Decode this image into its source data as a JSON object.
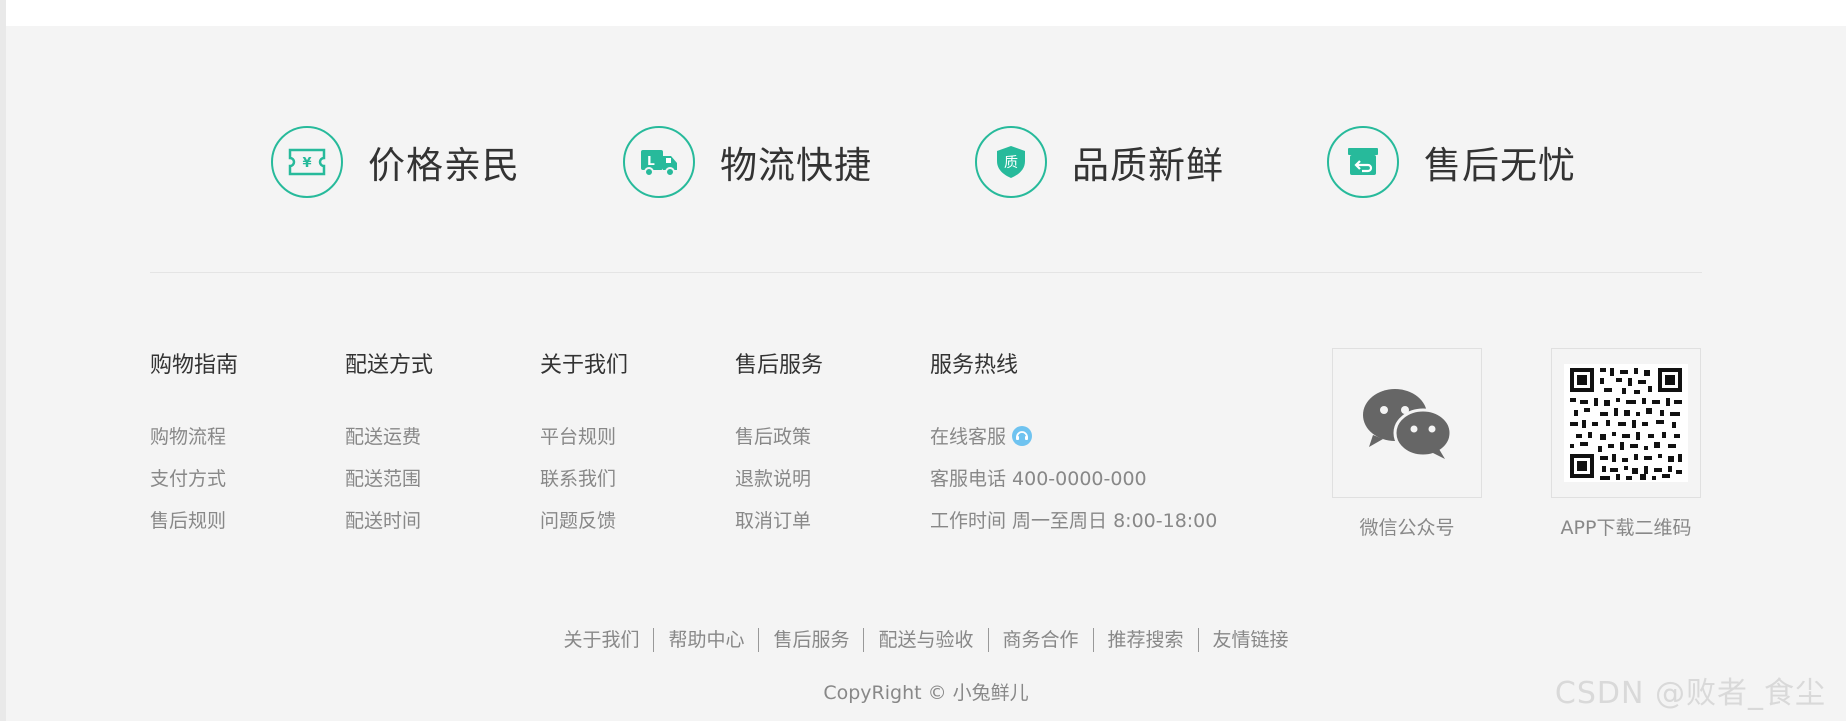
{
  "features": [
    {
      "label": "价格亲民",
      "icon": "ticket-yuan-icon"
    },
    {
      "label": "物流快捷",
      "icon": "delivery-truck-icon"
    },
    {
      "label": "品质新鲜",
      "icon": "quality-shield-icon"
    },
    {
      "label": "售后无忧",
      "icon": "return-box-icon"
    }
  ],
  "columns": [
    {
      "title": "购物指南",
      "links": [
        "购物流程",
        "支付方式",
        "售后规则"
      ]
    },
    {
      "title": "配送方式",
      "links": [
        "配送运费",
        "配送范围",
        "配送时间"
      ]
    },
    {
      "title": "关于我们",
      "links": [
        "平台规则",
        "联系我们",
        "问题反馈"
      ]
    },
    {
      "title": "售后服务",
      "links": [
        "售后政策",
        "退款说明",
        "取消订单"
      ]
    },
    {
      "title": "服务热线",
      "links": [
        "在线客服",
        "客服电话 400-0000-000",
        "工作时间 周一至周日 8:00-18:00"
      ]
    }
  ],
  "qr": [
    {
      "caption": "微信公众号",
      "icon": "wechat-icon"
    },
    {
      "caption": "APP下载二维码",
      "icon": "qr-code-icon"
    }
  ],
  "bottom_links": [
    "关于我们",
    "帮助中心",
    "售后服务",
    "配送与验收",
    "商务合作",
    "推荐搜索",
    "友情链接"
  ],
  "copyright": "CopyRight © 小兔鲜儿",
  "watermark": "CSDN @败者_食尘",
  "colors": {
    "accent": "#27ba9b",
    "background": "#f4f4f4",
    "text": "#333333",
    "muted": "#888888"
  }
}
